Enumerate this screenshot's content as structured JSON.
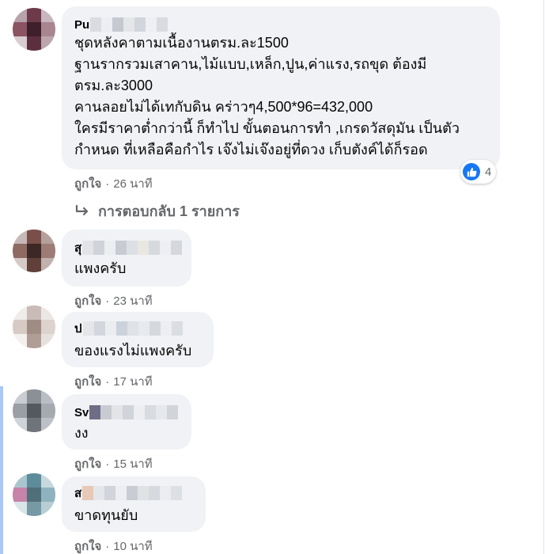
{
  "comments": [
    {
      "author": "Pu",
      "lines": [
        "ชุดหลังคาตามเนื้องานตรม.ละ1500",
        "ฐานรากรวมเสาคาน,ไม้แบบ,เหล็ก,ปูน,ค่าแรง,รถขุด ต้องมี",
        "ตรม.ละ3000",
        "คานลอยไม่ได้เทกับดิน คร่าวๆ4,500*96=432,000",
        "ใครมีราคาต่ำกว่านี้ ก็ทำไป ขั้นตอนการทำ ,เกรดวัสดุมัน เป็นตัว",
        "กำหนด ที่เหลือคือกำไร เจ๊งไม่เจ๊งอยู่ที่ดวง เก็บตังค์ได้ก็รอด"
      ],
      "like_label": "ถูกใจ",
      "time": "26 นาที",
      "reaction_count": "4"
    },
    {
      "author": "สุ",
      "lines": [
        "แพงครับ"
      ],
      "like_label": "ถูกใจ",
      "time": "23 นาที"
    },
    {
      "author": "ป",
      "lines": [
        "ของแรงไม่แพงครับ"
      ],
      "like_label": "ถูกใจ",
      "time": "17 นาที"
    },
    {
      "author": "Sv",
      "lines": [
        "งง"
      ],
      "like_label": "ถูกใจ",
      "time": "15 นาที"
    },
    {
      "author": "ส",
      "lines": [
        "ขาดทุนยับ"
      ],
      "like_label": "ถูกใจ",
      "time": "10 นาที"
    }
  ],
  "replies_link": {
    "label": "การตอบกลับ 1 รายการ",
    "icon": "reply-arrow-icon"
  },
  "colors": {
    "bubble": "#f0f2f5",
    "text": "#050505",
    "meta": "#65676b",
    "like_blue": "#1877f2",
    "side_stripe": "#a9c8f5"
  }
}
